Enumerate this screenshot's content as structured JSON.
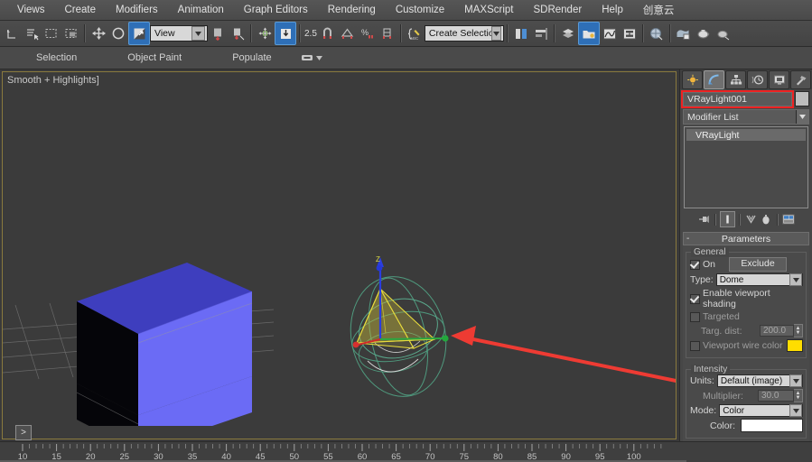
{
  "menu": {
    "items": [
      "Views",
      "Create",
      "Modifiers",
      "Animation",
      "Graph Editors",
      "Rendering",
      "Customize",
      "MAXScript",
      "SDRender",
      "Help",
      "创意云"
    ]
  },
  "toolbar": {
    "reference_coord_label": "View",
    "snap_percent_label": "2.5",
    "selection_set_placeholder": "Create Selection Set",
    "selection_set_value": "Create Selection Set",
    "icons": [
      "undo-icon",
      "redo-icon",
      "select-object-icon",
      "select-by-name-icon",
      "rectangular-select-region-icon",
      "window-crossing-icon",
      "select-and-move-icon",
      "select-and-rotate-icon",
      "reference-coordinate-icon",
      "use-pivot-center-icon",
      "select-and-manipulate-icon",
      "snaps-toggle-icon",
      "angle-snap-icon",
      "percent-snap-icon",
      "spinner-snap-icon",
      "edit-named-selection-sets-icon",
      "mirror-icon",
      "align-icon",
      "layer-manager-icon",
      "curve-editor-icon",
      "schematic-view-icon",
      "material-editor-icon",
      "render-setup-icon",
      "rendered-frame-window-icon",
      "render-production-icon"
    ]
  },
  "ribbon": {
    "tabs": [
      "Selection",
      "Object Paint",
      "Populate"
    ],
    "overflow_icon": "ribbon-menu-icon"
  },
  "viewport": {
    "label": "Smooth + Highlights]",
    "axis_z_label": "Z",
    "objects": [
      "box-object",
      "vray-dome-light-gizmo",
      "ground-grid"
    ]
  },
  "annotation": {
    "arrow_color": "#ee3b33",
    "name": "callout-arrow-type-dome"
  },
  "command_panel": {
    "tabs": [
      {
        "name": "create-tab",
        "icon": "create-star-icon",
        "active": false
      },
      {
        "name": "modify-tab",
        "icon": "modify-arc-icon",
        "active": true
      },
      {
        "name": "hierarchy-tab",
        "icon": "hierarchy-icon",
        "active": false
      },
      {
        "name": "motion-tab",
        "icon": "motion-clock-icon",
        "active": false
      },
      {
        "name": "display-tab",
        "icon": "display-monitor-icon",
        "active": false
      },
      {
        "name": "utilities-tab",
        "icon": "utilities-hammer-icon",
        "active": false
      }
    ],
    "object_name": "VRayLight001",
    "object_name_highlight_color": "#ee2222",
    "wire_color_swatch": "#bdbdbd",
    "modifier_list_label": "Modifier List",
    "stack": [
      "VRayLight"
    ],
    "stack_buttons": [
      "pin-stack-icon",
      "show-end-result-icon",
      "make-unique-icon",
      "remove-modifier-icon",
      "configure-modifier-sets-icon"
    ],
    "rollout": {
      "title": "Parameters",
      "collapse_glyph": "-",
      "general": {
        "label": "General",
        "on_label": "On",
        "on_checked": true,
        "exclude_label": "Exclude",
        "type_label": "Type:",
        "type_value": "Dome",
        "enable_viewport_shading_label": "Enable viewport shading",
        "enable_viewport_shading_checked": true,
        "targeted_label": "Targeted",
        "targeted_checked": false,
        "targ_dist_label": "Targ. dist:",
        "targ_dist_value": "200.0",
        "viewport_wire_color_label": "Viewport wire color",
        "viewport_wire_color_checked": false,
        "viewport_wire_color": "#ffdd00"
      },
      "intensity": {
        "label": "Intensity",
        "units_label": "Units:",
        "units_value": "Default (image)",
        "multiplier_label": "Multiplier:",
        "multiplier_value": "30.0",
        "mode_label": "Mode:",
        "mode_value": "Color",
        "color_label": "Color:",
        "color_value": "#ffffff"
      }
    }
  },
  "timeline": {
    "prompt_glyph": ">",
    "ticks": [
      "10",
      "15",
      "20",
      "25",
      "30",
      "35",
      "40",
      "45",
      "50",
      "55",
      "60",
      "65",
      "70",
      "75",
      "80",
      "85",
      "90",
      "95",
      "100"
    ]
  }
}
